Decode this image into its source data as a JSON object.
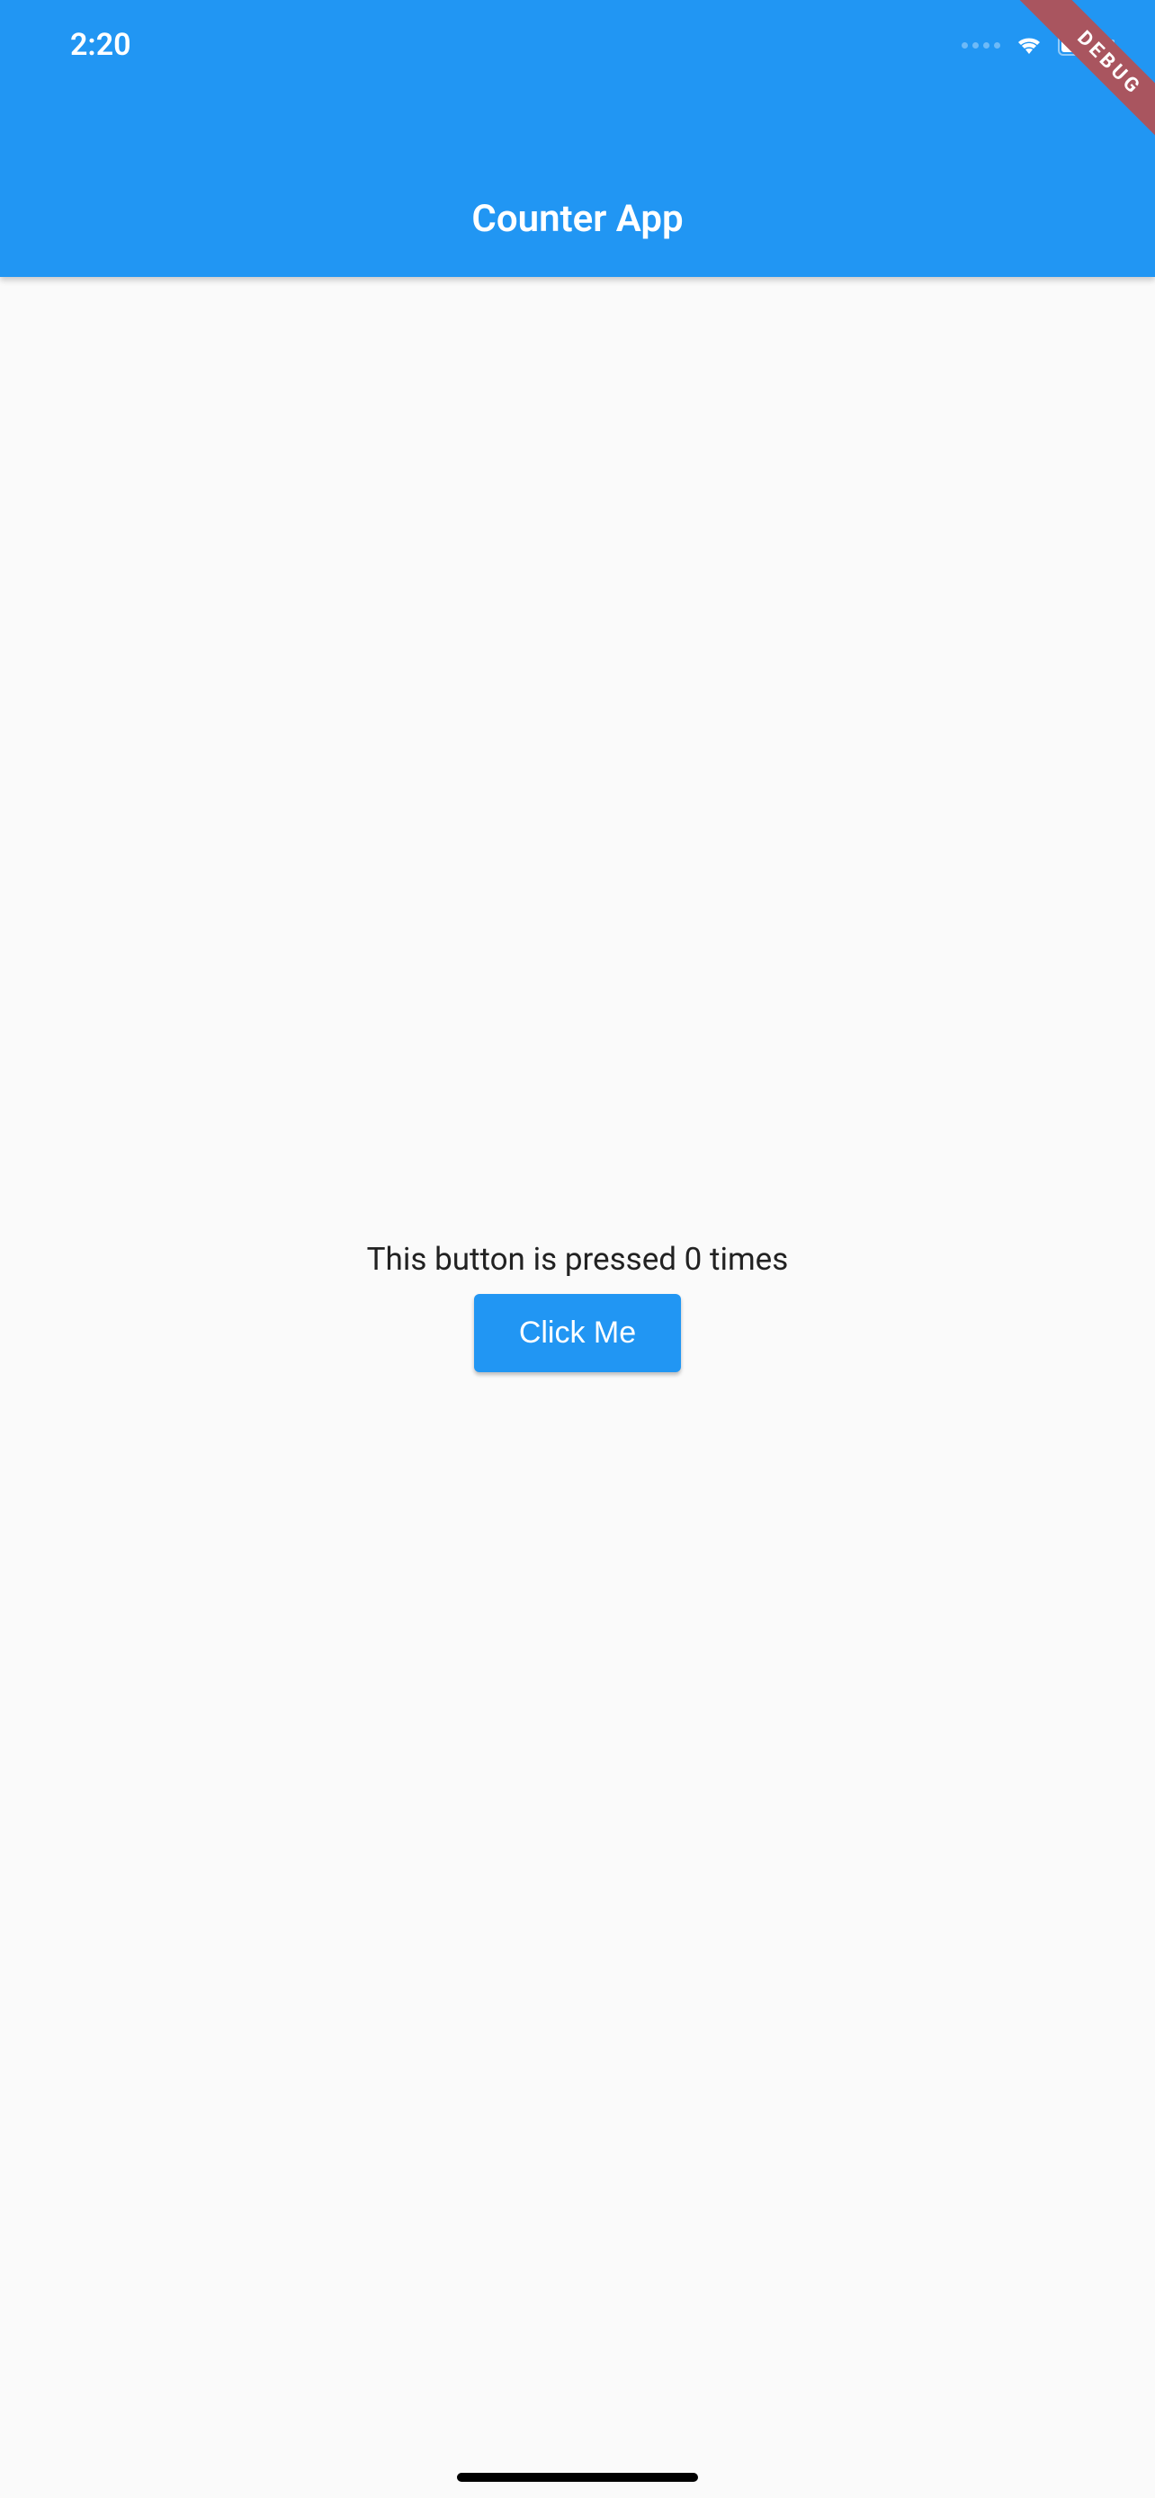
{
  "status_bar": {
    "time": "2:20"
  },
  "app_bar": {
    "title": "Counter App"
  },
  "debug_banner": {
    "label": "DEBUG"
  },
  "main": {
    "counter_text": "This button is pressed 0 times",
    "button_label": "Click Me"
  },
  "colors": {
    "primary": "#2196f3",
    "surface": "#fafafa"
  }
}
